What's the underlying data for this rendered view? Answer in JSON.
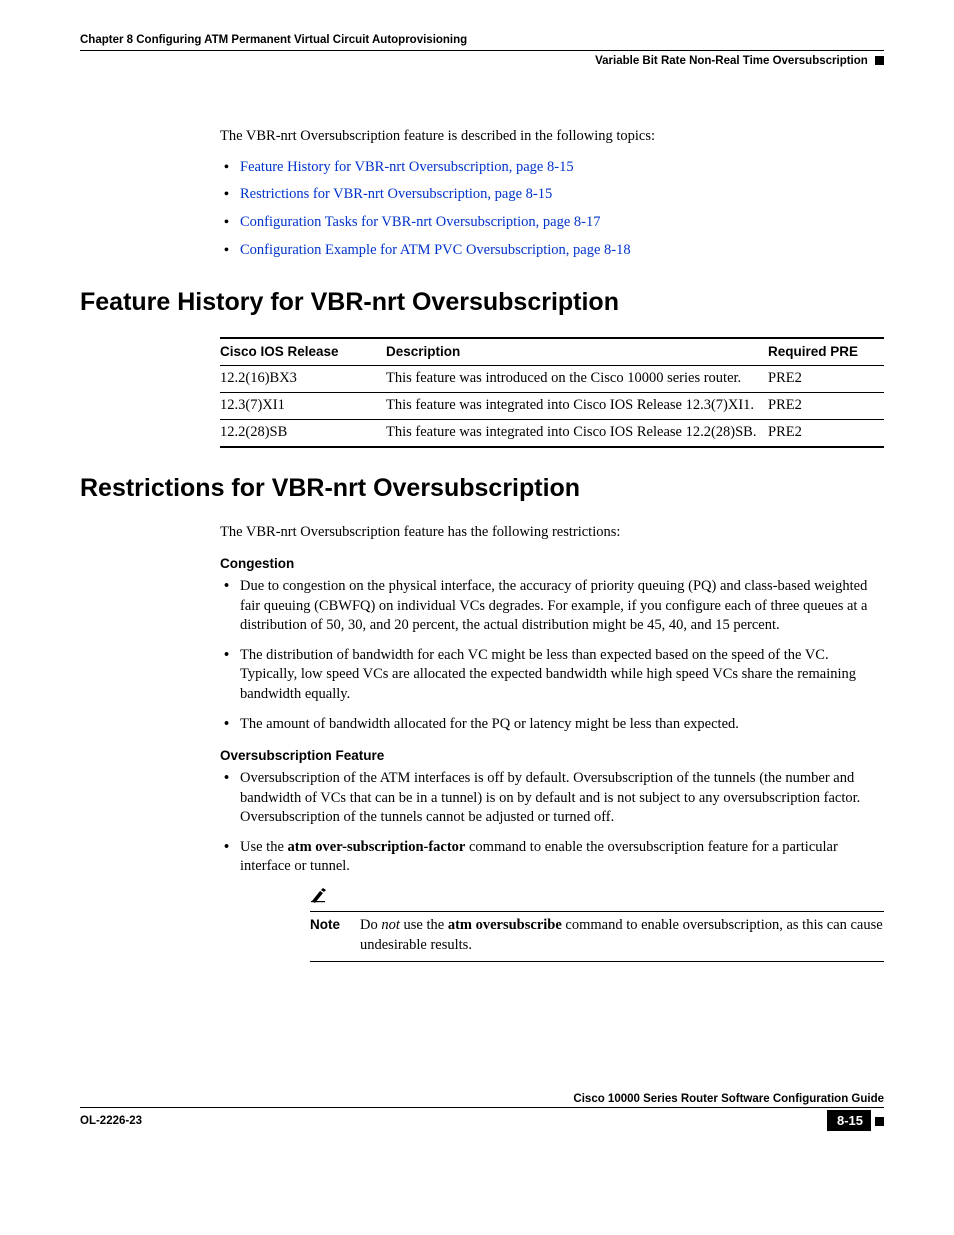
{
  "header": {
    "chapter": "Chapter 8      Configuring ATM Permanent Virtual Circuit Autoprovisioning",
    "section": "Variable Bit Rate Non-Real Time Oversubscription"
  },
  "intro": "The VBR-nrt Oversubscription feature is described in the following topics:",
  "topic_links": [
    "Feature History for VBR-nrt Oversubscription, page 8-15",
    "Restrictions for VBR-nrt Oversubscription, page 8-15",
    "Configuration Tasks for VBR-nrt Oversubscription, page 8-17",
    "Configuration Example for ATM PVC Oversubscription, page 8-18"
  ],
  "h_feature_history": "Feature History for VBR-nrt Oversubscription",
  "table": {
    "headers": {
      "c1": "Cisco IOS Release",
      "c2": "Description",
      "c3": "Required PRE"
    },
    "rows": [
      {
        "c1": "12.2(16)BX3",
        "c2": "This feature was introduced on the Cisco 10000 series router.",
        "c3": "PRE2"
      },
      {
        "c1": "12.3(7)XI1",
        "c2": "This feature was integrated into Cisco IOS Release 12.3(7)XI1.",
        "c3": "PRE2"
      },
      {
        "c1": "12.2(28)SB",
        "c2": "This feature was integrated into Cisco IOS Release 12.2(28)SB.",
        "c3": "PRE2"
      }
    ]
  },
  "h_restrictions": "Restrictions for VBR-nrt Oversubscription",
  "restrictions_intro": "The VBR-nrt Oversubscription feature has the following restrictions:",
  "congestion_hd": "Congestion",
  "congestion_items": [
    "Due to congestion on the physical interface, the accuracy of priority queuing (PQ) and class-based weighted fair queuing (CBWFQ) on individual VCs degrades. For example, if you configure each of three queues at a distribution of 50, 30, and 20 percent, the actual distribution might be 45, 40, and 15 percent.",
    "The distribution of bandwidth for each VC might be less than expected based on the speed of the VC. Typically, low speed VCs are allocated the expected bandwidth while high speed VCs share the remaining bandwidth equally.",
    "The amount of bandwidth allocated for the PQ or latency might be less than expected."
  ],
  "oversub_hd": "Oversubscription Feature",
  "oversub_item1": "Oversubscription of the ATM interfaces is off by default. Oversubscription of the tunnels (the number and bandwidth of VCs that can be in a tunnel) is on by default and is not subject to any oversubscription factor. Oversubscription of the tunnels cannot be adjusted or turned off.",
  "oversub_item2_pre": "Use the ",
  "oversub_item2_cmd": "atm over-subscription-factor",
  "oversub_item2_post": " command to enable the oversubscription feature for a particular interface or tunnel.",
  "note_label": "Note",
  "note_pre": "Do ",
  "note_not": "not",
  "note_mid": " use the ",
  "note_cmd": "atm oversubscribe",
  "note_post": " command to enable oversubscription, as this can cause undesirable results.",
  "footer": {
    "guide": "Cisco 10000 Series Router Software Configuration Guide",
    "doc_id": "OL-2226-23",
    "page": "8-15"
  }
}
